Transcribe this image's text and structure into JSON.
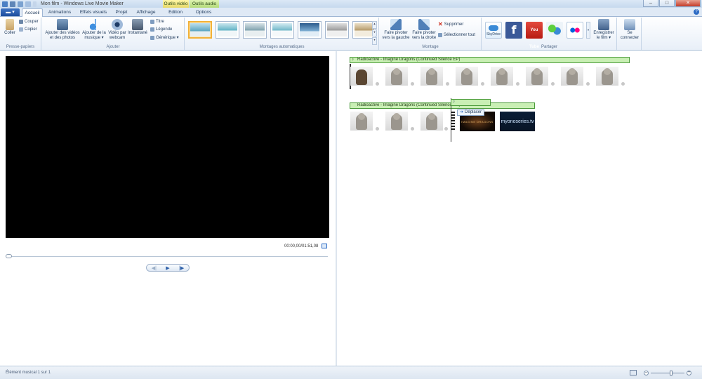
{
  "window": {
    "title": "Mon film - Windows Live Movie Maker",
    "context_tabs": {
      "video_tools": "Outils vidéo",
      "audio_tools": "Outils audio"
    },
    "controls": {
      "minimize": "–",
      "maximize": "□",
      "close": "✕"
    }
  },
  "tabs": {
    "app_menu": "▬ ▾",
    "items": [
      "Accueil",
      "Animations",
      "Effets visuels",
      "Projet",
      "Affichage",
      "Edition",
      "Options"
    ],
    "active": "Accueil",
    "help": "?"
  },
  "ribbon": {
    "clipboard": {
      "label": "Presse-papiers",
      "paste": "Coller",
      "cut": "Couper",
      "copy": "Copier"
    },
    "add": {
      "label": "Ajouter",
      "add_videos": [
        "Ajouter des vidéos",
        "et des photos"
      ],
      "add_music": [
        "Ajouter de la",
        "musique ▾"
      ],
      "webcam": [
        "Vidéo par",
        "webcam"
      ],
      "snapshot": "Instantané",
      "title": "Titre",
      "caption": "Légende",
      "credits": "Générique ▾"
    },
    "automovie": {
      "label": "Montages automatiques",
      "themes": 7,
      "selected_index": 0
    },
    "editing": {
      "label": "Montage",
      "rotate_left": [
        "Faire pivoter",
        "vers la gauche"
      ],
      "rotate_right": [
        "Faire pivoter",
        "vers la droite"
      ],
      "delete": "Supprimer",
      "select_all": "Sélectionner tout"
    },
    "share": {
      "label": "Partager",
      "skydrive": "SkyDrive",
      "save_movie": [
        "Enregistrer",
        "le film ▾"
      ],
      "sign_in": [
        "Se",
        "connecter"
      ]
    }
  },
  "preview": {
    "timecode": "00:00,00/01:51,08",
    "seek_position": 0
  },
  "storyboard": {
    "music_track_1": "Radioactive - Imagine Dragons (Continued Silence EP)",
    "music_track_2": "Radioactive - Imagine Dragons (Continued Silence EP)",
    "drag_tooltip": "Déplacer",
    "clip_logo": "myonoseries.tv",
    "clip_tagline": "IMAGINE DRAGONS"
  },
  "status": {
    "text": "Élément musical 1 sur 1",
    "zoom_level": 0.62
  },
  "colors": {
    "music_fill": "#c9efb4",
    "music_border": "#4b9b3a",
    "accent": "#2b6ac4"
  }
}
